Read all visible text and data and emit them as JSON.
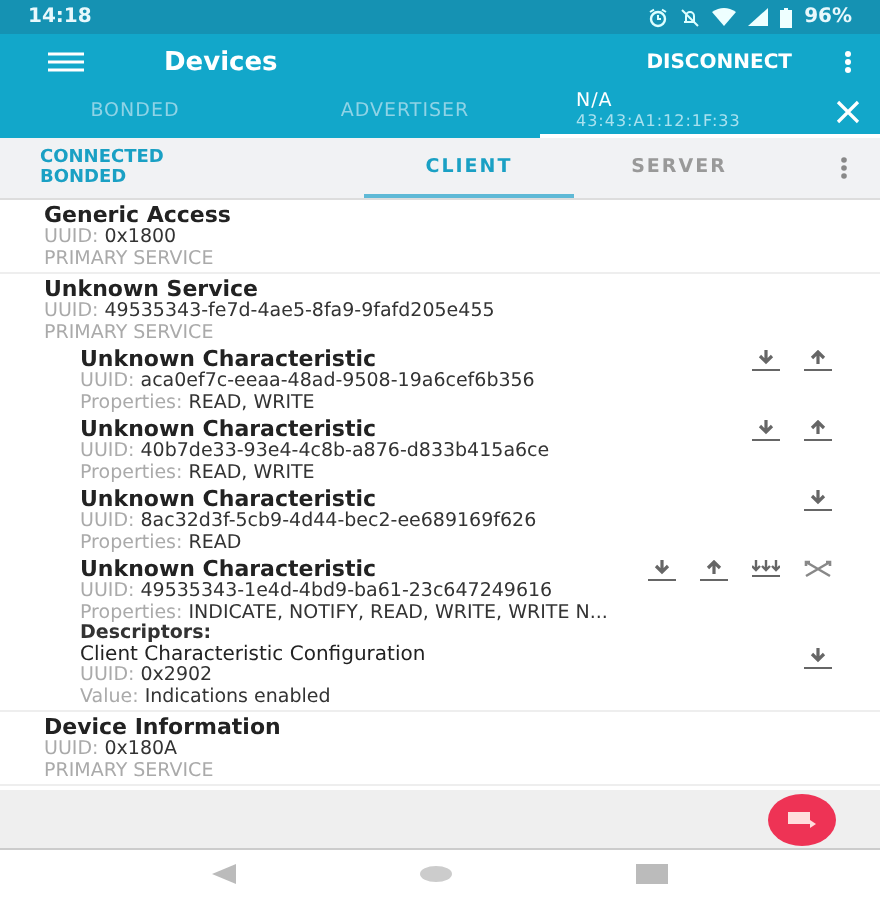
{
  "status_bar": {
    "time": "14:18",
    "battery": "96%"
  },
  "app_bar": {
    "title": "Devices",
    "action": "DISCONNECT"
  },
  "tabs": [
    {
      "label": "BONDED",
      "selected": false
    },
    {
      "label": "ADVERTISER",
      "selected": false
    },
    {
      "label": "N/A",
      "sublabel": "43:43:A1:12:1F:33",
      "selected": true
    }
  ],
  "connection": {
    "state": "CONNECTED",
    "bond": "BONDED"
  },
  "sub_tabs": [
    {
      "label": "CLIENT",
      "selected": true
    },
    {
      "label": "SERVER",
      "selected": false
    }
  ],
  "services": [
    {
      "name": "Generic Access",
      "uuid_label": "UUID:",
      "uuid": "0x1800",
      "type": "PRIMARY SERVICE"
    },
    {
      "name": "Unknown Service",
      "uuid_label": "UUID:",
      "uuid": "49535343-fe7d-4ae5-8fa9-9fafd205e455",
      "type": "PRIMARY SERVICE",
      "characteristics": [
        {
          "name": "Unknown Characteristic",
          "uuid_label": "UUID:",
          "uuid": "aca0ef7c-eeaa-48ad-9508-19a6cef6b356",
          "properties_label": "Properties:",
          "properties": "READ, WRITE",
          "read": true,
          "write": true
        },
        {
          "name": "Unknown Characteristic",
          "uuid_label": "UUID:",
          "uuid": "40b7de33-93e4-4c8b-a876-d833b415a6ce",
          "properties_label": "Properties:",
          "properties": "READ, WRITE",
          "read": true,
          "write": true
        },
        {
          "name": "Unknown Characteristic",
          "uuid_label": "UUID:",
          "uuid": "8ac32d3f-5cb9-4d44-bec2-ee689169f626",
          "properties_label": "Properties:",
          "properties": "READ",
          "read": true
        },
        {
          "name": "Unknown Characteristic",
          "uuid_label": "UUID:",
          "uuid": "49535343-1e4d-4bd9-ba61-23c647249616",
          "properties_label": "Properties:",
          "properties": "INDICATE, NOTIFY, READ, WRITE, WRITE N...",
          "read": true,
          "write": true,
          "notify": true,
          "indicate": true,
          "descriptors_title": "Descriptors:",
          "descriptors": [
            {
              "name": "Client Characteristic Configuration",
              "uuid_label": "UUID:",
              "uuid": "0x2902",
              "value_label": "Value:",
              "value": "Indications enabled",
              "read": true
            }
          ]
        }
      ]
    },
    {
      "name": "Device Information",
      "uuid_label": "UUID:",
      "uuid": "0x180A",
      "type": "PRIMARY SERVICE"
    }
  ]
}
